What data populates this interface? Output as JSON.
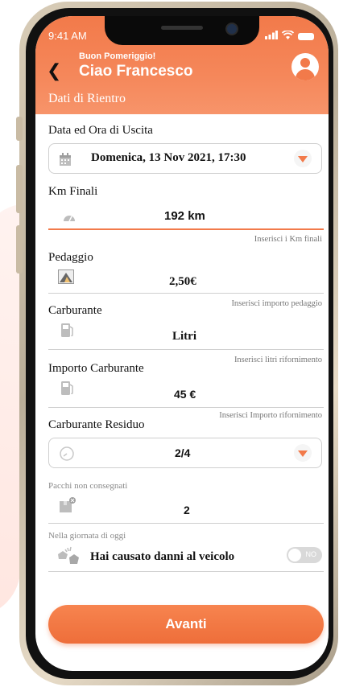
{
  "status_bar": {
    "time": "9:41 AM"
  },
  "header": {
    "greeting": "Buon Pomeriggio!",
    "user_name": "Ciao Francesco",
    "back_symbol": "❮",
    "section_title": "Dati di Rientro"
  },
  "form": {
    "exit_datetime": {
      "label": "Data ed Ora di Uscita",
      "value": "Domenica,  13 Nov 2021, 17:30",
      "icon": "calendar-icon"
    },
    "km_finali": {
      "label": "Km Finali",
      "value": "192 km",
      "hint": "Inserisci i Km finali",
      "icon": "speedometer-icon"
    },
    "pedaggio": {
      "label": "Pedaggio",
      "value": "2,50€",
      "hint": "Inserisci importo pedaggio",
      "icon": "toll-icon"
    },
    "carburante": {
      "label": "Carburante",
      "value": "Litri",
      "hint": "Inserisci litri rifornimento",
      "icon": "fuel-icon"
    },
    "importo_carburante": {
      "label": "Importo Carburante",
      "value": "45 €",
      "hint": "Inserisci Importo rifornimento",
      "icon": "fuel-icon"
    },
    "carburante_residuo": {
      "label": "Carburante Residuo",
      "value": "2/4",
      "icon": "gauge-icon"
    },
    "pacchi": {
      "label": "Pacchi non consegnati",
      "value": "2",
      "icon": "package-icon"
    },
    "danni": {
      "label": "Nella giornata di oggi",
      "question": "Hai causato danni al veicolo",
      "toggle_label": "NO",
      "icon": "car-crash-icon"
    }
  },
  "actions": {
    "next_label": "Avanti"
  },
  "colors": {
    "accent": "#f27a4a",
    "button": "#ee6e3a"
  }
}
